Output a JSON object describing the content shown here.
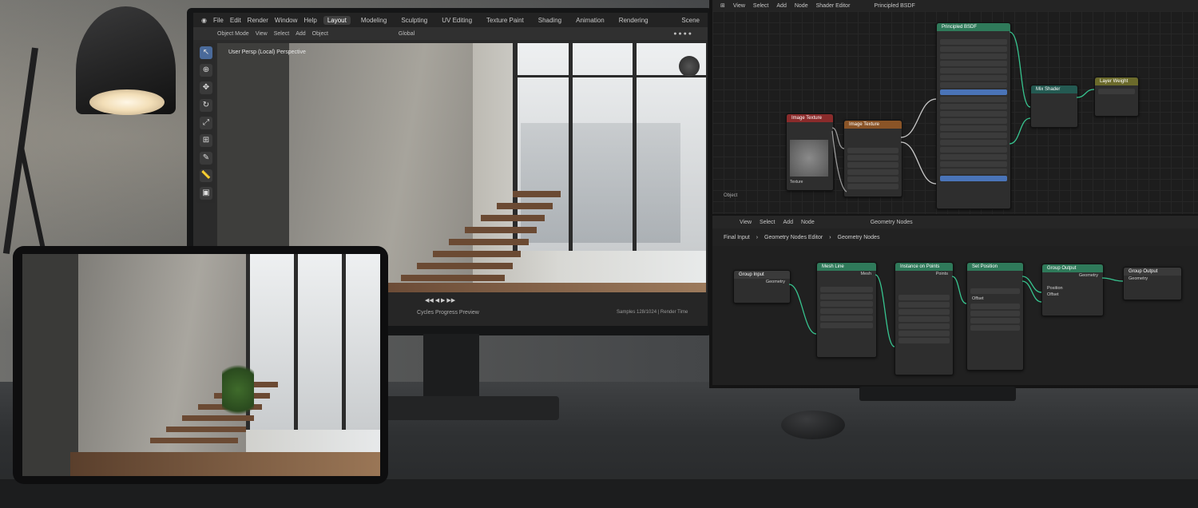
{
  "monitor": {
    "top_menu": [
      "File",
      "Edit",
      "Render",
      "Window",
      "Help"
    ],
    "workspace_tabs": [
      "Layout",
      "Modeling",
      "Sculpting",
      "UV Editing",
      "Texture Paint",
      "Shading",
      "Animation",
      "Rendering"
    ],
    "active_tab": "Layout",
    "header_items": [
      "Object Mode",
      "View",
      "Select",
      "Add",
      "Object"
    ],
    "scene_selector": "Scene",
    "viewport_label": "User Persp (Local) Perspective",
    "orientation": "Global",
    "status_text": "Cycles Progress Preview",
    "status_right": "Samples 128/1024 | Render Time"
  },
  "node_editor_top": {
    "menu": [
      "View",
      "Select",
      "Add",
      "Node"
    ],
    "editor_title": "Shader Editor",
    "material": "Principled BSDF",
    "object_label": "Object",
    "nodes": {
      "principled": "Principled BSDF",
      "image": "Image Texture",
      "texture": "Image Texture",
      "mix": "Mix Shader",
      "output": "Layer Weight"
    },
    "image_node_label": "Texture"
  },
  "node_editor_bottom": {
    "menu": [
      "View",
      "Select",
      "Add",
      "Node"
    ],
    "editor_name": "Geometry Nodes",
    "breadcrumb": [
      "Final Input",
      "Geometry Nodes Editor",
      "Geometry Nodes"
    ],
    "nodes": {
      "group_input": "Group Input",
      "mesh_line": "Mesh Line",
      "instance": "Instance on Points",
      "set_position": "Set Position",
      "join": "Group Output",
      "group_output": "Group Output"
    },
    "sockets": {
      "geometry": "Geometry",
      "points": "Points",
      "mesh": "Mesh",
      "position": "Position",
      "offset": "Offset"
    }
  },
  "colors": {
    "node_link": "#37c48f",
    "header_green": "#2f7a5a",
    "active_blue": "#4a74b8"
  }
}
